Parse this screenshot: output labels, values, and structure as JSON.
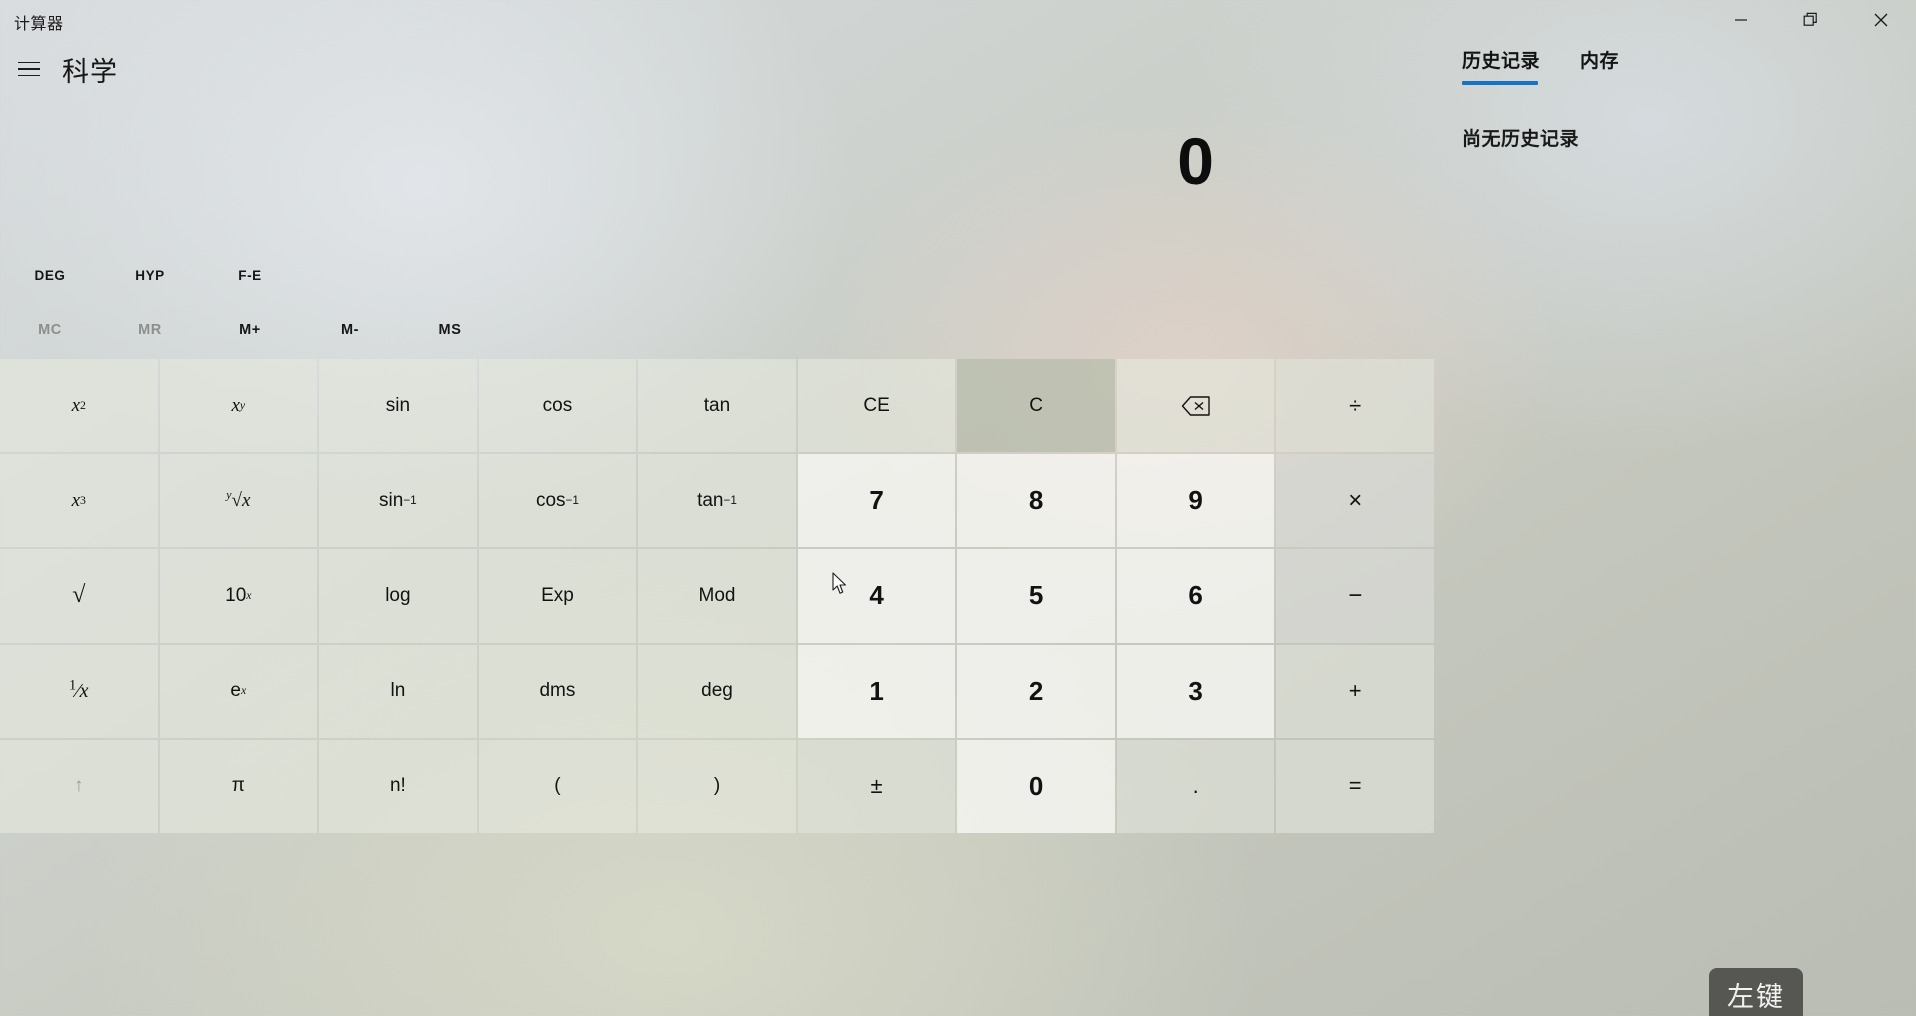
{
  "window": {
    "title": "计算器",
    "controls": [
      {
        "name": "minimize",
        "icon": "minimize-icon"
      },
      {
        "name": "restore",
        "icon": "restore-icon"
      },
      {
        "name": "close",
        "icon": "close-icon"
      }
    ]
  },
  "nav": {
    "menu_icon": "hamburger-menu-icon",
    "mode_title": "科学"
  },
  "right_panel": {
    "tabs": [
      {
        "label": "历史记录",
        "active": true
      },
      {
        "label": "内存",
        "active": false
      }
    ],
    "empty_message": "尚无历史记录",
    "accent_color": "#1a72c4"
  },
  "display": {
    "value": "0"
  },
  "toggles": [
    {
      "label": "DEG",
      "disabled": false
    },
    {
      "label": "HYP",
      "disabled": false
    },
    {
      "label": "F-E",
      "disabled": false
    }
  ],
  "memory": [
    {
      "label": "MC",
      "disabled": true
    },
    {
      "label": "MR",
      "disabled": true
    },
    {
      "label": "M+",
      "disabled": false
    },
    {
      "label": "M-",
      "disabled": false
    },
    {
      "label": "MS",
      "disabled": false
    }
  ],
  "keypad": {
    "rows": [
      [
        {
          "name": "square",
          "label": "x²"
        },
        {
          "name": "power-y",
          "label": "xʸ"
        },
        {
          "name": "sin",
          "label": "sin"
        },
        {
          "name": "cos",
          "label": "cos"
        },
        {
          "name": "tan",
          "label": "tan"
        },
        {
          "name": "clear-entry",
          "label": "CE"
        },
        {
          "name": "clear",
          "label": "C"
        },
        {
          "name": "backspace",
          "label": "⌫"
        },
        {
          "name": "divide",
          "label": "÷"
        }
      ],
      [
        {
          "name": "cube",
          "label": "x³"
        },
        {
          "name": "root-y",
          "label": "ʸ√x"
        },
        {
          "name": "asin",
          "label": "sin⁻¹"
        },
        {
          "name": "acos",
          "label": "cos⁻¹"
        },
        {
          "name": "atan",
          "label": "tan⁻¹"
        },
        {
          "name": "seven",
          "label": "7"
        },
        {
          "name": "eight",
          "label": "8"
        },
        {
          "name": "nine",
          "label": "9"
        },
        {
          "name": "multiply",
          "label": "×"
        }
      ],
      [
        {
          "name": "sqrt",
          "label": "√"
        },
        {
          "name": "ten-power-x",
          "label": "10ˣ"
        },
        {
          "name": "log",
          "label": "log"
        },
        {
          "name": "exp",
          "label": "Exp"
        },
        {
          "name": "mod",
          "label": "Mod"
        },
        {
          "name": "four",
          "label": "4"
        },
        {
          "name": "five",
          "label": "5"
        },
        {
          "name": "six",
          "label": "6"
        },
        {
          "name": "subtract",
          "label": "−"
        }
      ],
      [
        {
          "name": "reciprocal",
          "label": "¹/x"
        },
        {
          "name": "e-power-x",
          "label": "eˣ"
        },
        {
          "name": "ln",
          "label": "ln"
        },
        {
          "name": "dms",
          "label": "dms"
        },
        {
          "name": "deg",
          "label": "deg"
        },
        {
          "name": "one",
          "label": "1"
        },
        {
          "name": "two",
          "label": "2"
        },
        {
          "name": "three",
          "label": "3"
        },
        {
          "name": "add",
          "label": "+"
        }
      ],
      [
        {
          "name": "shift-up",
          "label": "↑"
        },
        {
          "name": "pi",
          "label": "π"
        },
        {
          "name": "factorial",
          "label": "n!"
        },
        {
          "name": "open-paren",
          "label": "("
        },
        {
          "name": "close-paren",
          "label": ")"
        },
        {
          "name": "plus-minus",
          "label": "±"
        },
        {
          "name": "zero",
          "label": "0"
        },
        {
          "name": "decimal",
          "label": "."
        },
        {
          "name": "equals",
          "label": "="
        }
      ]
    ]
  },
  "overlay": {
    "click_badge": "左键"
  }
}
